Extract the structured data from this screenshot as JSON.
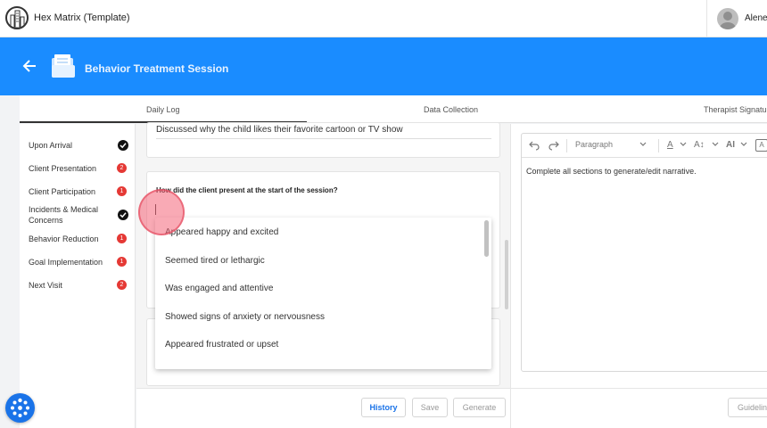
{
  "app": {
    "title": "Hex Matrix (Template)"
  },
  "user": {
    "name": "Alene"
  },
  "banner": {
    "title": "Behavior Treatment Session"
  },
  "tabs": [
    {
      "label": "Daily Log"
    },
    {
      "label": "Data Collection"
    },
    {
      "label": "Therapist Signature"
    }
  ],
  "sidebar": {
    "items": [
      {
        "label": "Upon Arrival",
        "status": "complete",
        "count": ""
      },
      {
        "label": "Client Presentation",
        "status": "pending",
        "count": "2"
      },
      {
        "label": "Client Participation",
        "status": "pending",
        "count": "1"
      },
      {
        "label": "Incidents & Medical Concerns",
        "status": "complete",
        "count": ""
      },
      {
        "label": "Behavior Reduction",
        "status": "pending",
        "count": "1"
      },
      {
        "label": "Goal Implementation",
        "status": "pending",
        "count": "1"
      },
      {
        "label": "Next Visit",
        "status": "pending",
        "count": "2"
      }
    ]
  },
  "form": {
    "previous_answer": "Discussed why the child likes their favorite cartoon or TV show",
    "question": "How did the client present at the start of the session?",
    "answer_value": "",
    "options": [
      "Appeared happy and excited",
      "Seemed tired or lethargic",
      "Was engaged and attentive",
      "Showed signs of anxiety or nervousness",
      "Appeared frustrated or upset"
    ]
  },
  "actions": {
    "history": "History",
    "save": "Save",
    "generate": "Generate"
  },
  "editor": {
    "block_format": "Paragraph",
    "font_color_glyph": "A",
    "font_size_glyph": "A↕",
    "ai_glyph": "AI",
    "narrative_placeholder": "Complete all sections to generate/edit narrative.",
    "guidelines_button": "Guidelines"
  },
  "colors": {
    "brand": "#1a8cff",
    "badge": "#e53935",
    "link": "#1a73e8"
  }
}
